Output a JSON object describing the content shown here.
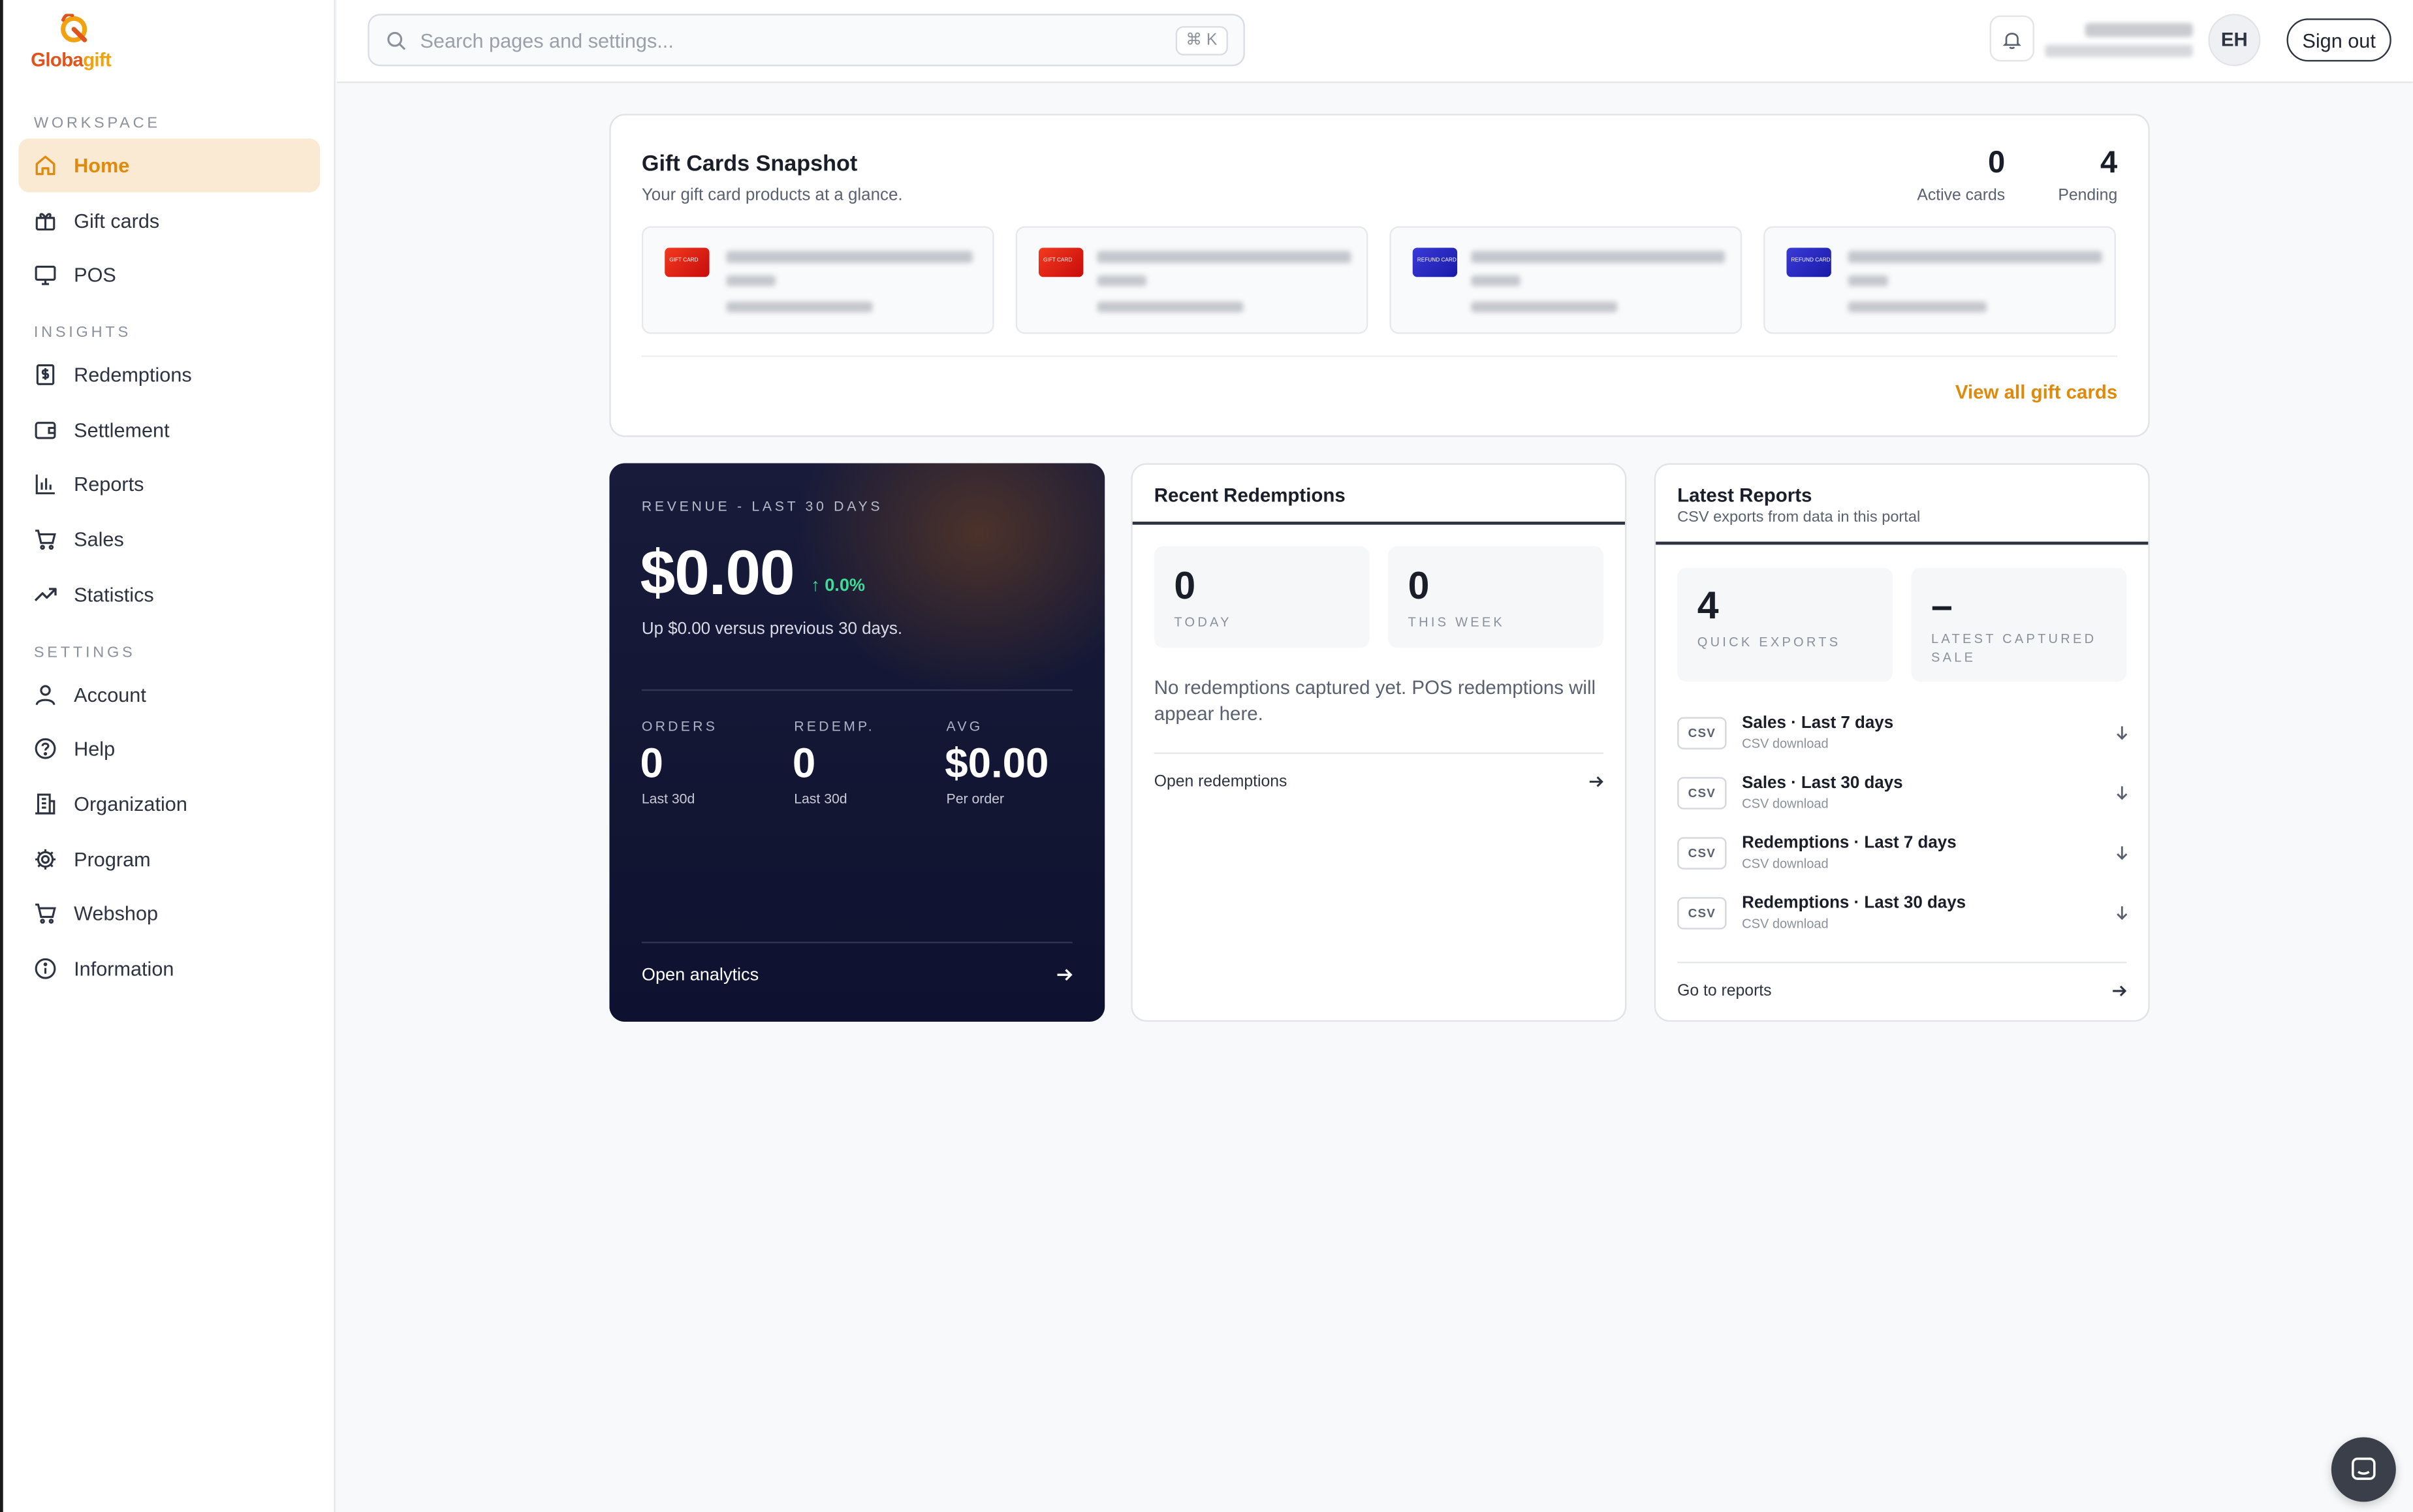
{
  "brand": {
    "name_part1": "Globa",
    "name_part2": "gift"
  },
  "sidebar": {
    "sections": [
      {
        "label": "WORKSPACE"
      },
      {
        "label": "INSIGHTS"
      },
      {
        "label": "SETTINGS"
      }
    ],
    "items": [
      {
        "label": "Home",
        "icon": "home-icon",
        "active": true
      },
      {
        "label": "Gift cards",
        "icon": "gift-icon"
      },
      {
        "label": "POS",
        "icon": "monitor-icon"
      },
      {
        "label": "Redemptions",
        "icon": "dollar-receipt-icon"
      },
      {
        "label": "Settlement",
        "icon": "wallet-icon"
      },
      {
        "label": "Reports",
        "icon": "bar-chart-icon"
      },
      {
        "label": "Sales",
        "icon": "cart-icon"
      },
      {
        "label": "Statistics",
        "icon": "trending-up-icon"
      },
      {
        "label": "Account",
        "icon": "user-icon"
      },
      {
        "label": "Help",
        "icon": "help-circle-icon"
      },
      {
        "label": "Organization",
        "icon": "building-icon"
      },
      {
        "label": "Program",
        "icon": "gear-icon"
      },
      {
        "label": "Webshop",
        "icon": "cart-icon"
      },
      {
        "label": "Information",
        "icon": "info-icon"
      }
    ]
  },
  "topbar": {
    "search_placeholder": "Search pages and settings...",
    "shortcut": "⌘ K",
    "avatar_initials": "EH",
    "signout_label": "Sign out"
  },
  "snapshot": {
    "title": "Gift Cards Snapshot",
    "subtitle": "Your gift card products at a glance.",
    "active_value": "0",
    "active_label": "Active cards",
    "pending_value": "4",
    "pending_label": "Pending",
    "tiles": [
      {
        "thumb_color": "#e0201a",
        "thumb_text": "GIFT CARD"
      },
      {
        "thumb_color": "#e0201a",
        "thumb_text": "GIFT CARD"
      },
      {
        "thumb_color": "#2828c0",
        "thumb_text": "REFUND CARD"
      },
      {
        "thumb_color": "#2828c0",
        "thumb_text": "REFUND CARD"
      }
    ],
    "view_all": "View all gift cards"
  },
  "revenue": {
    "eyebrow": "REVENUE - LAST 30 DAYS",
    "amount": "$0.00",
    "delta": "↑ 0.0%",
    "note": "Up $0.00 versus previous 30 days.",
    "metrics": [
      {
        "label": "ORDERS",
        "value": "0",
        "sub": "Last 30d"
      },
      {
        "label": "REDEMP.",
        "value": "0",
        "sub": "Last 30d"
      },
      {
        "label": "AVG",
        "value": "$0.00",
        "sub": "Per order"
      }
    ],
    "footer_link": "Open analytics"
  },
  "recent": {
    "title": "Recent Redemptions",
    "today_value": "0",
    "today_label": "TODAY",
    "week_value": "0",
    "week_label": "THIS WEEK",
    "empty_message": "No redemptions captured yet. POS redemptions will appear here.",
    "link": "Open redemptions"
  },
  "reports": {
    "title": "Latest Reports",
    "subtitle": "CSV exports from data in this portal",
    "quick_value": "4",
    "quick_label": "QUICK EXPORTS",
    "latest_value": "–",
    "latest_label_1": "LATEST CAPTURED",
    "latest_label_2": "SALE",
    "rows": [
      {
        "badge": "CSV",
        "title": "Sales · Last 7 days",
        "sub": "CSV download"
      },
      {
        "badge": "CSV",
        "title": "Sales · Last 30 days",
        "sub": "CSV download"
      },
      {
        "badge": "CSV",
        "title": "Redemptions · Last 7 days",
        "sub": "CSV download"
      },
      {
        "badge": "CSV",
        "title": "Redemptions · Last 30 days",
        "sub": "CSV download"
      }
    ],
    "link": "Go to reports"
  },
  "colors": {
    "accent": "#e08a0c",
    "active_bg": "#fbead3",
    "positive": "#3ddc97",
    "revenue_bg": "#141836"
  }
}
